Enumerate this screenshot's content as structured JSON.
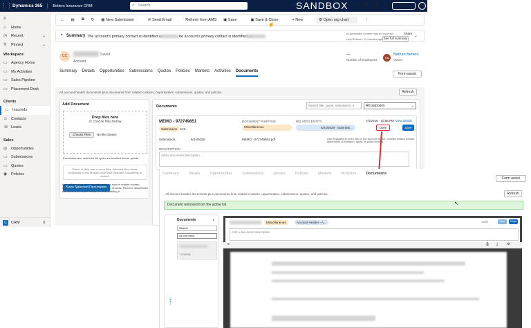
{
  "topbar": {
    "brand": "Dynamics 365",
    "app": "Betters Insurance CRM",
    "search": "Search",
    "env": "SANDBOX",
    "copilot": "Copilot",
    "initials": "NB"
  },
  "sidenav": {
    "items_top": [
      {
        "icon": "home-icon",
        "label": "Home"
      },
      {
        "icon": "clock-icon",
        "label": "Recent"
      },
      {
        "icon": "pin-icon",
        "label": "Pinned"
      }
    ],
    "workspace_title": "Workspace",
    "workspace": [
      "Agency Home",
      "My Activities",
      "Sales Pipeline",
      "Placement Desk"
    ],
    "clients_title": "Clients",
    "clients": [
      "Insureds",
      "Contacts",
      "Leads"
    ],
    "sales_title": "Sales",
    "sales": [
      "Opportunities",
      "Submissions",
      "Quotes",
      "Policies"
    ],
    "bottom": "CRM",
    "bottom_badge": "C"
  },
  "cmdbar": [
    "New Submission",
    "Send Email",
    "Refresh from AMS",
    "Save",
    "Save & Close",
    "New",
    "Open org chart"
  ],
  "summary": {
    "title": "Summary",
    "text1": "The account's primary contact is identified as",
    "text2": "he account's primary contact is identified as",
    "ai": "AI-generated content may be incorrect",
    "share": "Share",
    "refresh": "Last Refresh: 13 minutes ago",
    "see_full": "See full summary"
  },
  "header": {
    "initials": "CC",
    "saved": "Saved",
    "type": "Account",
    "employees_val": "---",
    "employees": "Number of Employees",
    "owner_initials": "NB",
    "owner": "Nathan Betters",
    "owner_role": "Owner"
  },
  "tabs": [
    "Summary",
    "Details",
    "Opportunities",
    "Submissions",
    "Quotes",
    "Policies",
    "Markets",
    "Activities",
    "Documents"
  ],
  "form_assist": "Form assist",
  "docs": {
    "desc": "All account header documents plus documents from related contacts, opportunities, submissions, quotes, and policies.",
    "refresh": "Refresh",
    "add_title": "Add Document",
    "drop": "Drop files here",
    "or": "or choose files below",
    "choose": "Choose Files",
    "nofile": "No file chosen",
    "blocked": "Executable and restricted file types are blocked before upload.",
    "select_hint": "Select or drop one or more files. Selected files remain temporary in this browser until Save Selected Documents is clicked.",
    "save_selected": "Save Selected Documents",
    "leave_hint": "Leave Regarding as Account Header, or search related contact, opportunity, submission, quote, or policy records. Remove deactivates the document record instead of hard-deleting it.",
    "documents": "Documents",
    "search_ph": "Search title, quote, submission, o",
    "filter": "All purposes"
  },
  "memo": {
    "title": "MEMO - 972749851",
    "tag": "Submission",
    "id": "11:0",
    "purpose_label": "Document purpose",
    "purpose": "Miscellaneous",
    "related_label": "Related entity",
    "related": "6/24/2026 - Submissi...",
    "date": "7/1/2026 · 10:58 PM",
    "view": "View details",
    "open": "Open",
    "save": "Save",
    "sub_line": "Submission",
    "sub_date": "6/24/2026",
    "file": "MEMO - 972749851.pdf",
    "regard_hint": "Use Regarding to keep this on the account header or select related contact, opportunity, submission, quote, or policy records.",
    "desc_label": "Description",
    "desc_ph": "Add a document description"
  },
  "shot2": {
    "tabs": [
      "Summary",
      "Details",
      "Opportunities",
      "Submissions",
      "Quotes",
      "Policies",
      "Markets",
      "Activities",
      "Documents"
    ],
    "form_assist": "Form assist",
    "desc": "All account header documents plus documents from related contacts, opportunities, submissions, quotes, and policies.",
    "refresh": "Refresh",
    "notice": "Document removed from the active list.",
    "documents": "Documents",
    "search": "Search",
    "filter": "All purposes",
    "purpose": "Miscellaneous",
    "related": "Account Header - A...",
    "zoom": "100%",
    "desc_ph": "Add a document description",
    "save": "Save",
    "close": "Close",
    "item_date": "7/10/2026"
  }
}
